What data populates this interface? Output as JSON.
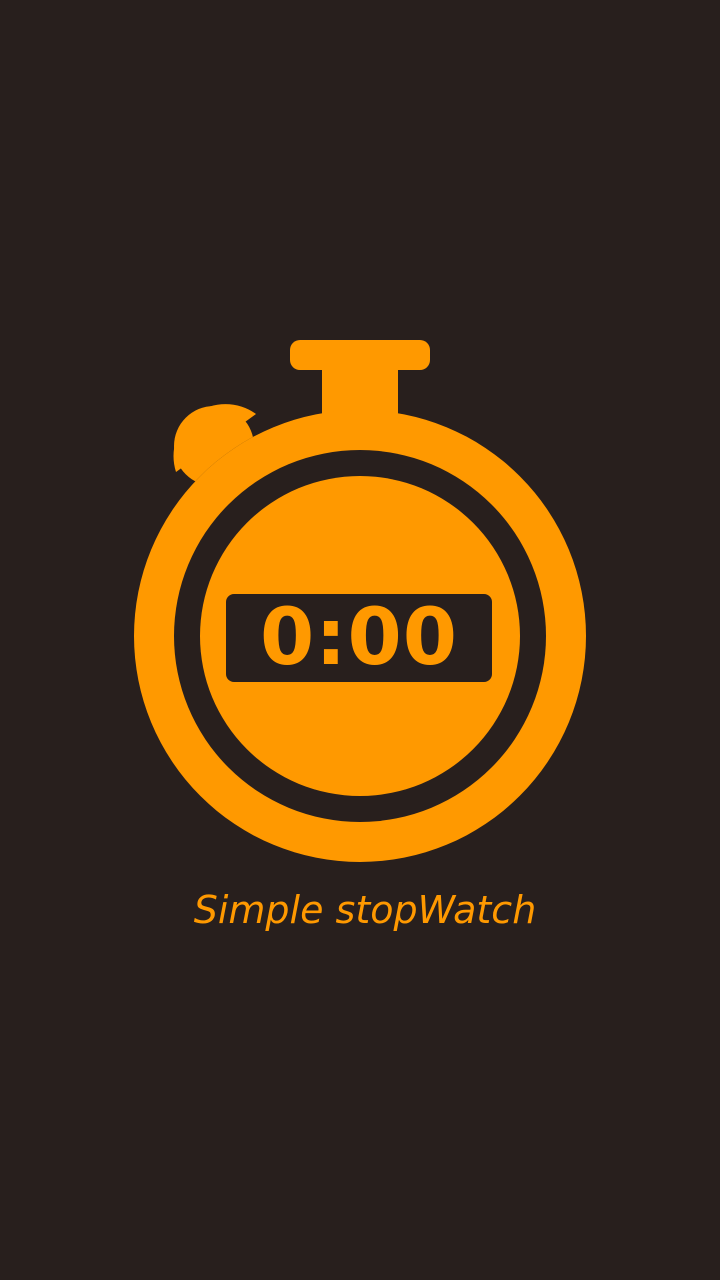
{
  "splash": {
    "display_time": "0:00",
    "app_name": "Simple stopWatch",
    "icon": "stopwatch-icon"
  },
  "colors": {
    "background": "#281f1d",
    "accent": "#ff9900"
  }
}
